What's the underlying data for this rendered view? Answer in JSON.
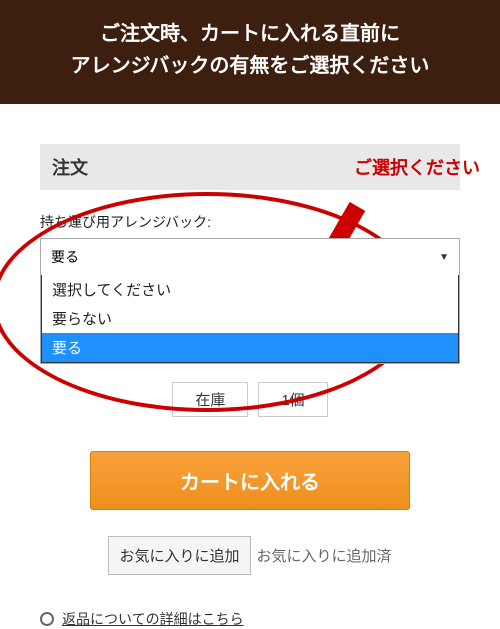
{
  "banner": {
    "line1": "ご注文時、カートに入れる直前に",
    "line2": "アレンジバックの有無をご選択ください"
  },
  "callout": "ご選択ください",
  "section_title": "注文",
  "field": {
    "label": "持ち運び用アレンジバック:",
    "selected": "要る",
    "options": [
      "選択してください",
      "要らない",
      "要る"
    ]
  },
  "stock": {
    "label": "在庫",
    "qty": "1個"
  },
  "cart_button": "カートに入れる",
  "favorite": {
    "add": "お気に入りに追加",
    "done": "お気に入りに追加済"
  },
  "return_link": "返品についての詳細はこちら",
  "colors": {
    "accent_red": "#cc0000",
    "cart_orange": "#ef8f1d",
    "highlight_blue": "#1e90ff"
  }
}
